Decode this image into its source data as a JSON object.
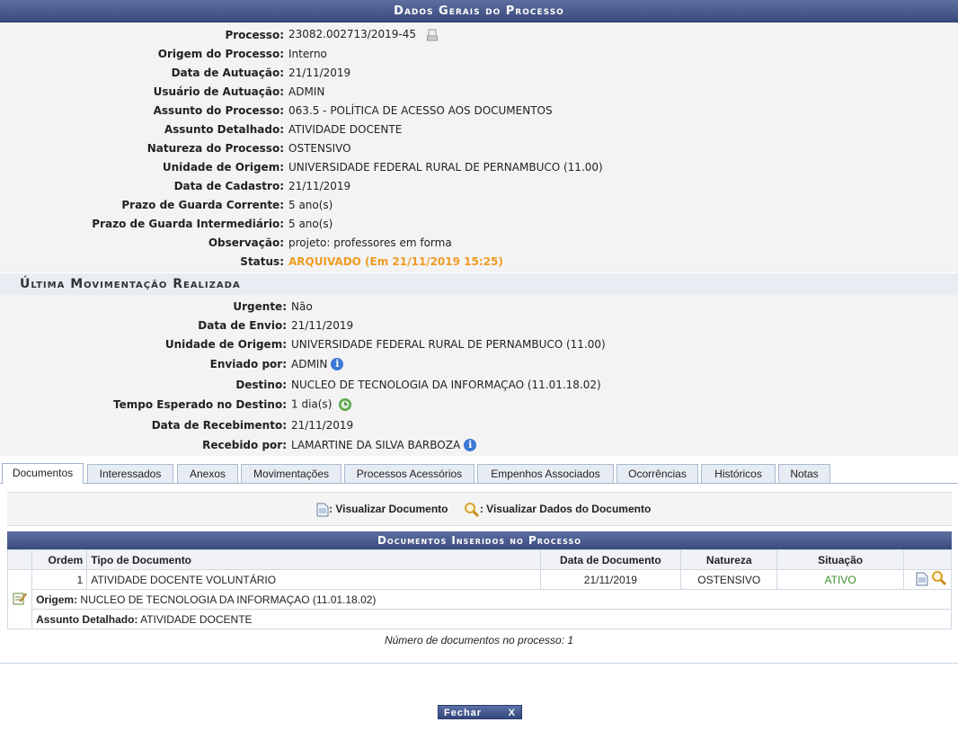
{
  "title": "Dados Gerais do Processo",
  "process_fields": [
    {
      "label": "Processo:",
      "value": "23082.002713/2019-45"
    },
    {
      "label": "Origem do Processo:",
      "value": "Interno"
    },
    {
      "label": "Data de Autuação:",
      "value": "21/11/2019"
    },
    {
      "label": "Usuário de Autuação:",
      "value": "ADMIN"
    },
    {
      "label": "Assunto do Processo:",
      "value": "063.5 - POLÍTICA DE ACESSO AOS DOCUMENTOS"
    },
    {
      "label": "Assunto Detalhado:",
      "value": "ATIVIDADE DOCENTE"
    },
    {
      "label": "Natureza do Processo:",
      "value": "OSTENSIVO"
    },
    {
      "label": "Unidade de Origem:",
      "value": "UNIVERSIDADE FEDERAL RURAL DE PERNAMBUCO (11.00)"
    },
    {
      "label": "Data de Cadastro:",
      "value": "21/11/2019"
    },
    {
      "label": "Prazo de Guarda Corrente:",
      "value": "5 ano(s)"
    },
    {
      "label": "Prazo de Guarda Intermediário:",
      "value": "5 ano(s)"
    },
    {
      "label": "Observação:",
      "value": "projeto: professores em forma"
    },
    {
      "label": "Status:",
      "value": "ARQUIVADO (Em 21/11/2019 15:25)"
    }
  ],
  "movement_title": "Última Movimentação Realizada",
  "movement_fields": [
    {
      "label": "Urgente:",
      "value": "Não"
    },
    {
      "label": "Data de Envio:",
      "value": "21/11/2019"
    },
    {
      "label": "Unidade de Origem:",
      "value": "UNIVERSIDADE FEDERAL RURAL DE PERNAMBUCO (11.00)"
    },
    {
      "label": "Enviado por:",
      "value": "ADMIN"
    },
    {
      "label": "Destino:",
      "value": "NUCLEO DE TECNOLOGIA DA INFORMAÇAO (11.01.18.02)"
    },
    {
      "label": "Tempo Esperado no Destino:",
      "value": "1 dia(s)"
    },
    {
      "label": "Data de Recebimento:",
      "value": "21/11/2019"
    },
    {
      "label": "Recebido por:",
      "value": "LAMARTINE DA SILVA BARBOZA"
    }
  ],
  "tabs": [
    "Documentos",
    "Interessados",
    "Anexos",
    "Movimentações",
    "Processos Acessórios",
    "Empenhos Associados",
    "Ocorrências",
    "Históricos",
    "Notas"
  ],
  "legend": {
    "view_doc": ": Visualizar Documento",
    "view_data": ": Visualizar Dados do Documento"
  },
  "docs_table": {
    "title": "Documentos Inseridos no Processo",
    "headers": [
      "Ordem",
      "Tipo de Documento",
      "Data de Documento",
      "Natureza",
      "Situação"
    ],
    "row": {
      "ordem": "1",
      "tipo": "ATIVIDADE DOCENTE VOLUNTÁRIO",
      "data": "21/11/2019",
      "natureza": "OSTENSIVO",
      "situacao": "ATIVO"
    },
    "origem_label": "Origem:",
    "origem_value": "NUCLEO DE TECNOLOGIA DA INFORMAÇAO (11.01.18.02)",
    "assunto_label": "Assunto Detalhado:",
    "assunto_value": "ATIVIDADE DOCENTE"
  },
  "footnote": "Número de documentos no processo: 1",
  "close_button": {
    "label": "Fechar",
    "x": "X"
  },
  "colors": {
    "header": "#3a4a7c",
    "status": "#ef9c22",
    "active": "#3a8f2a"
  }
}
